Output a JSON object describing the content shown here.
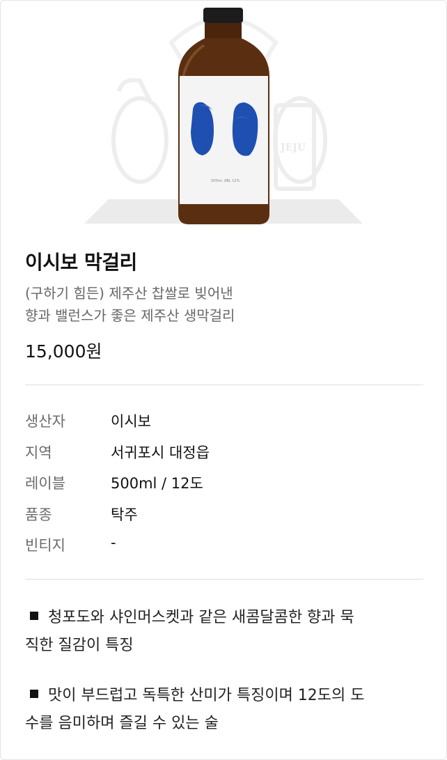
{
  "product": {
    "name": "이시보 막걸리",
    "description": [
      "(구하기 힘든) 제주산 찹쌀로 빚어낸",
      "향과 밸런스가 좋은 제주산 생막걸리"
    ],
    "price": "15,000원",
    "image": {
      "bottle_label_text": "500ml, ABL 12%",
      "background_logo_text": "JEJU"
    }
  },
  "specs": [
    {
      "key": "생산자",
      "value": "이시보"
    },
    {
      "key": "지역",
      "value": "서귀포시 대정읍"
    },
    {
      "key": "레이블",
      "value": "500ml / 12도"
    },
    {
      "key": "품종",
      "value": "탁주"
    },
    {
      "key": "빈티지",
      "value": "-"
    }
  ],
  "notes": [
    {
      "line1": "청포도와 샤인머스켓과 같은 새콤달콤한 향과 묵",
      "line2": "직한 질감이 특징"
    },
    {
      "line1": "맛이 부드럽고 독특한 산미가 특징이며 12도의 도",
      "line2": "수를 음미하며 즐길 수 있는 술"
    }
  ],
  "colors": {
    "eye_blue": "#1f4fb0",
    "bottle_brown": "#5a2e10",
    "muted_text": "#666666"
  }
}
